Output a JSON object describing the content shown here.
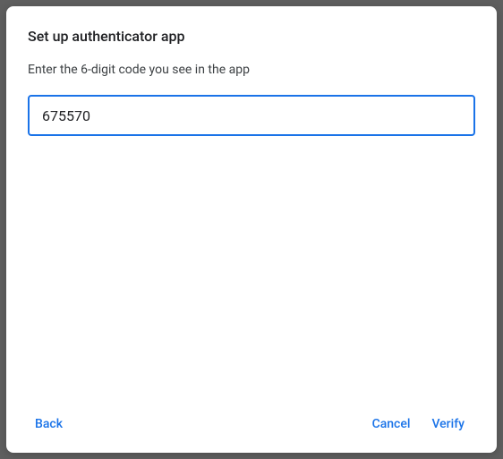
{
  "dialog": {
    "title": "Set up authenticator app",
    "instruction": "Enter the 6-digit code you see in the app",
    "code_value": "675570",
    "buttons": {
      "back": "Back",
      "cancel": "Cancel",
      "verify": "Verify"
    }
  }
}
